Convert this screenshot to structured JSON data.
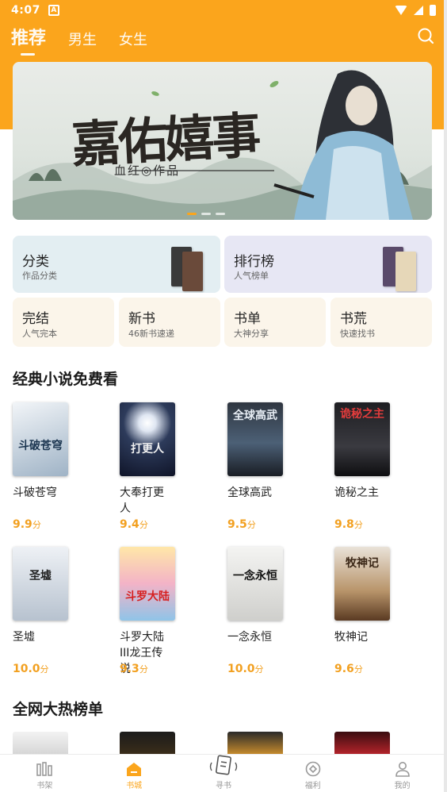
{
  "status_bar": {
    "time": "4:07",
    "app_badge": "A"
  },
  "header": {
    "tabs": [
      {
        "label": "推荐",
        "active": true
      },
      {
        "label": "男生",
        "active": false
      },
      {
        "label": "女生",
        "active": false
      }
    ],
    "search_icon": "search-icon",
    "accent_color": "#fba51c"
  },
  "banner": {
    "title": "嘉佑嬉事",
    "subtitle": "血红◎作品",
    "slide_index": 1,
    "slide_count": 3
  },
  "categories": {
    "big": [
      {
        "title": "分类",
        "subtitle": "作品分类"
      },
      {
        "title": "排行榜",
        "subtitle": "人气榜单"
      }
    ],
    "small": [
      {
        "title": "完结",
        "subtitle": "人气完本"
      },
      {
        "title": "新书",
        "subtitle": "46新书速递"
      },
      {
        "title": "书单",
        "subtitle": "大神分享"
      },
      {
        "title": "书荒",
        "subtitle": "快速找书"
      }
    ]
  },
  "section_classic": {
    "title": "经典小说免费看",
    "books": [
      {
        "name": "斗破苍穹",
        "score": "9.9",
        "unit": "分",
        "cover_text": "斗破苍穹"
      },
      {
        "name": "大奉打更人",
        "score": "9.4",
        "unit": "分",
        "cover_text": "打更人"
      },
      {
        "name": "全球高武",
        "score": "9.5",
        "unit": "分",
        "cover_text": "全球高武"
      },
      {
        "name": "诡秘之主",
        "score": "9.8",
        "unit": "分",
        "cover_text": "诡秘之主"
      },
      {
        "name": "圣墟",
        "score": "10.0",
        "unit": "分",
        "cover_text": "圣墟"
      },
      {
        "name": "斗罗大陆III龙王传说",
        "score": "9.3",
        "unit": "分",
        "cover_text": "斗罗大陆"
      },
      {
        "name": "一念永恒",
        "score": "10.0",
        "unit": "分",
        "cover_text": "一念永恒"
      },
      {
        "name": "牧神记",
        "score": "9.6",
        "unit": "分",
        "cover_text": "牧神记"
      }
    ]
  },
  "section_hot": {
    "title": "全网大热榜单"
  },
  "bottom_nav": [
    {
      "label": "书架",
      "icon": "bookshelf-icon",
      "active": false
    },
    {
      "label": "书城",
      "icon": "bookstore-icon",
      "active": true
    },
    {
      "label": "寻书",
      "icon": "find-book-icon",
      "active": false
    },
    {
      "label": "福利",
      "icon": "welfare-icon",
      "active": false
    },
    {
      "label": "我的",
      "icon": "profile-icon",
      "active": false
    }
  ]
}
